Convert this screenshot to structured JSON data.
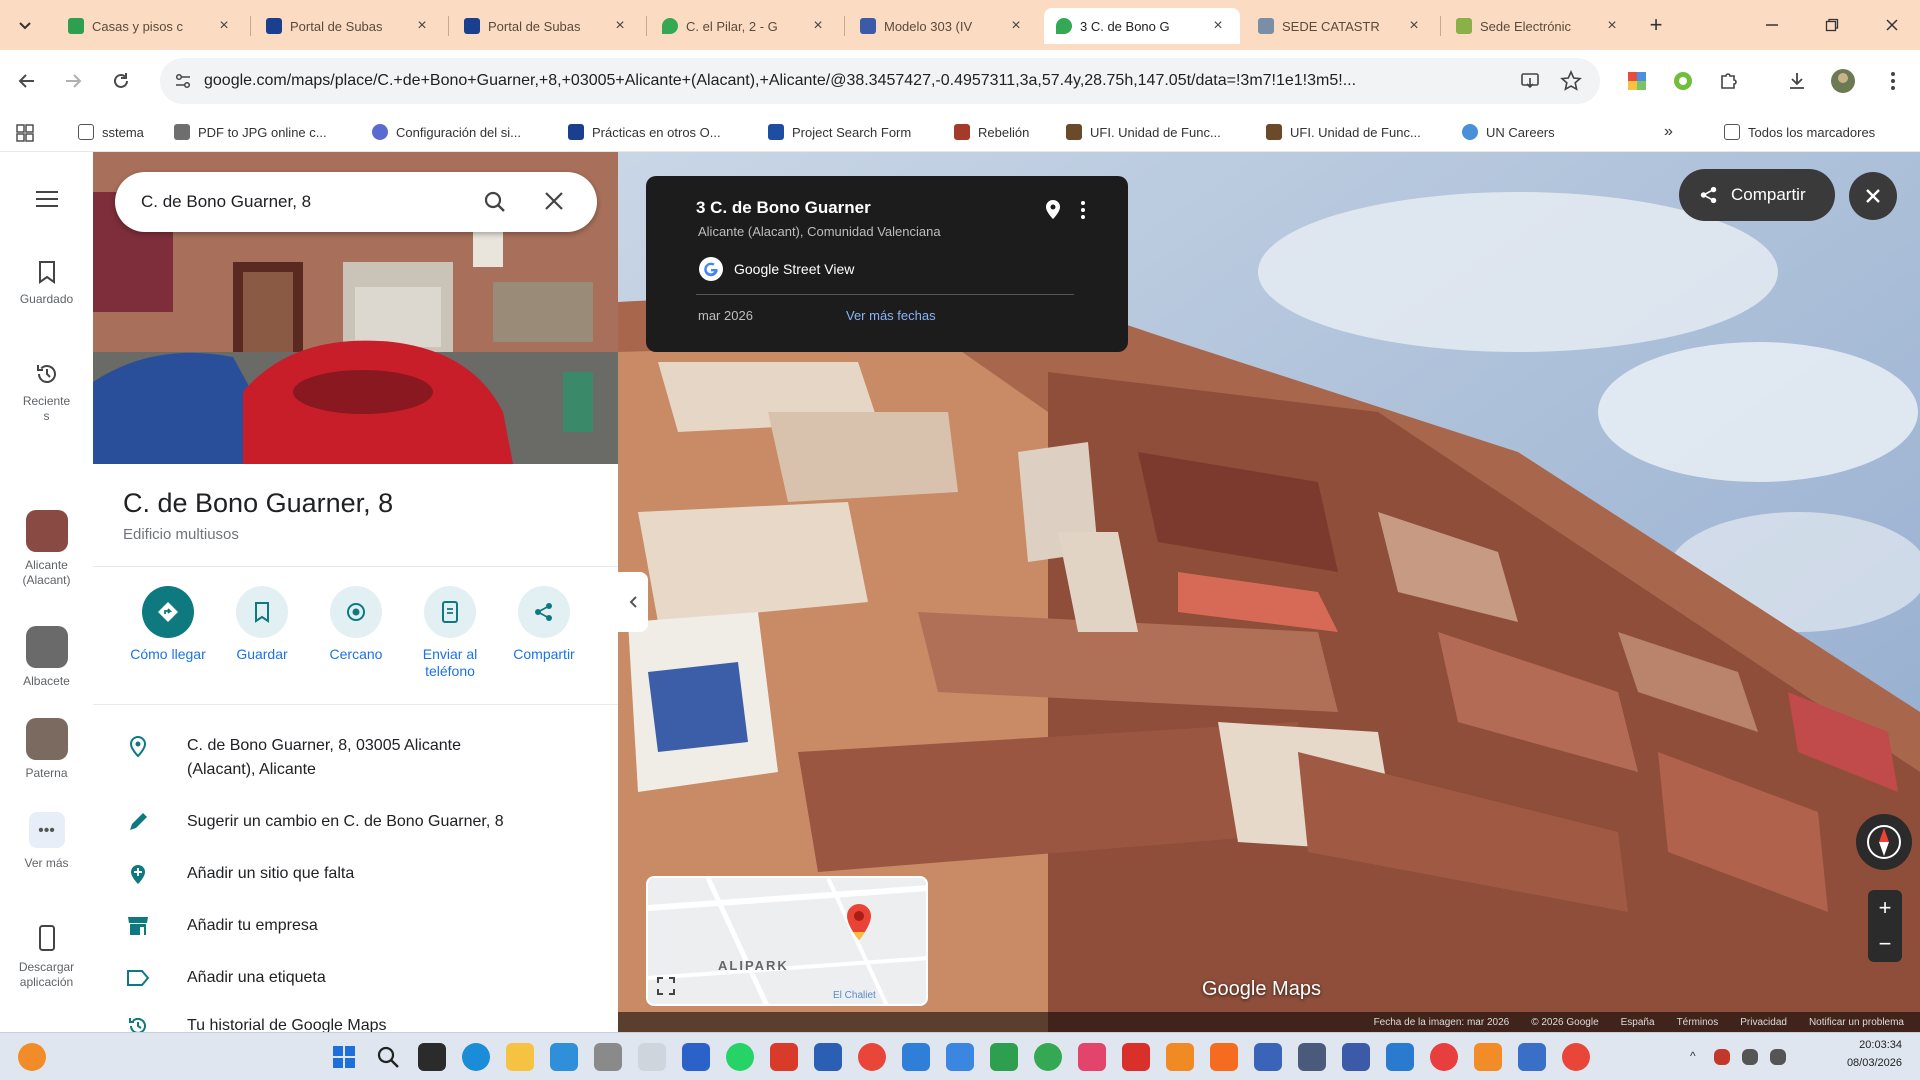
{
  "browser": {
    "tabs": [
      {
        "label": "Casas y pisos c",
        "color": "#2e9e4f"
      },
      {
        "label": "Portal de Subas",
        "color": "#1b3f8f"
      },
      {
        "label": "Portal de Subas",
        "color": "#1b3f8f"
      },
      {
        "label": "C. el Pilar, 2 - G",
        "color": "#34a853"
      },
      {
        "label": "Modelo 303 (IV",
        "color": "#3b5ba9"
      },
      {
        "label": "3 C. de Bono G",
        "color": "#34a853",
        "active": true
      },
      {
        "label": "SEDE CATASTR",
        "color": "#7b8ea8"
      },
      {
        "label": "Sede Electrónic",
        "color": "#8bb04a"
      }
    ],
    "new_tab": "+",
    "url": "google.com/maps/place/C.+de+Bono+Guarner,+8,+03005+Alicante+(Alacant),+Alicante/@38.3457427,-0.4957311,3a,57.4y,28.75h,147.05t/data=!3m7!1e1!3m5!...",
    "bookmarks": [
      {
        "label": "sstema",
        "color": "#f2b134"
      },
      {
        "label": "PDF to JPG online c...",
        "color": "#6e6e6e"
      },
      {
        "label": "Configuración del si...",
        "color": "#5b6ad0"
      },
      {
        "label": "Prácticas en otros O...",
        "color": "#1b3f8f"
      },
      {
        "label": "Project Search Form",
        "color": "#1e4ea1"
      },
      {
        "label": "Rebelión",
        "color": "#a33a2a"
      },
      {
        "label": "UFI. Unidad de Func...",
        "color": "#6b4a2a"
      },
      {
        "label": "UFI. Unidad de Func...",
        "color": "#6b4a2a"
      },
      {
        "label": "UN Careers",
        "color": "#4a90d9"
      }
    ],
    "bookmarks_more": "»",
    "all_bookmarks": "Todos los marcadores"
  },
  "rail": {
    "saved": "Guardado",
    "recent": "Reciente\ns",
    "recents": [
      {
        "label": "Alicante\n(Alacant)",
        "color": "#8a4a44"
      },
      {
        "label": "Albacete",
        "color": "#6a6a6a"
      },
      {
        "label": "Paterna",
        "color": "#7a6a60"
      }
    ],
    "more": "Ver más",
    "download": "Descargar\naplicación"
  },
  "panel": {
    "search_value": "C. de Bono Guarner, 8",
    "title": "C. de Bono Guarner, 8",
    "subtitle": "Edificio multiusos",
    "actions": [
      {
        "label": "Cómo llegar"
      },
      {
        "label": "Guardar"
      },
      {
        "label": "Cercano"
      },
      {
        "label": "Enviar al\nteléfono"
      },
      {
        "label": "Compartir"
      }
    ],
    "address": "C. de Bono Guarner, 8, 03005 Alicante\n(Alacant), Alicante",
    "suggest": "Sugerir un cambio en C. de Bono Guarner, 8",
    "add_place": "Añadir un sitio que falta",
    "add_business": "Añadir tu empresa",
    "add_label": "Añadir una etiqueta",
    "history": "Tu historial de Google Maps"
  },
  "streetview": {
    "title": "3 C. de Bono Guarner",
    "subtitle": "Alicante (Alacant), Comunidad Valenciana",
    "source": "Google Street View",
    "date": "mar 2026",
    "more_dates": "Ver más fechas",
    "share": "Compartir",
    "minimap_label": "ALIPARK",
    "minimap_label2": "El Chaliet",
    "watermark": "Google Maps",
    "footer": [
      "Fecha de la imagen: mar 2026",
      "© 2026 Google",
      "España",
      "Términos",
      "Privacidad",
      "Notificar un problema"
    ],
    "zoom_in": "+",
    "zoom_out": "−"
  },
  "taskbar": {
    "time": "20:03:34",
    "date": "08/03/2026"
  }
}
